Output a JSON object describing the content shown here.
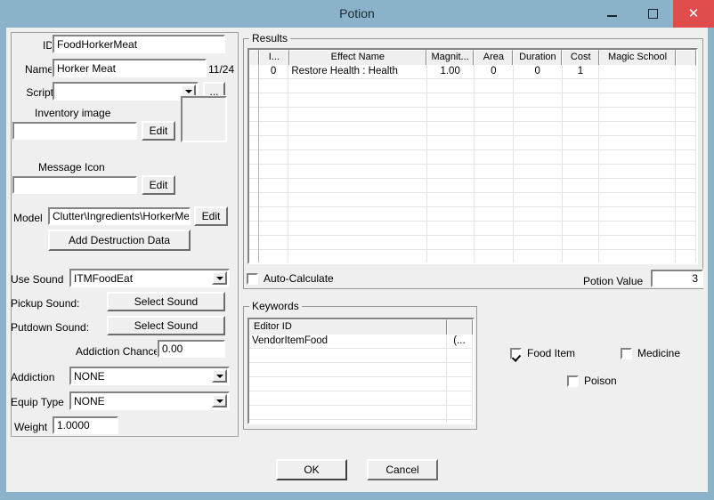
{
  "window": {
    "title": "Potion",
    "minimize": "–",
    "maximize": "□",
    "close": "✕"
  },
  "left_panel": {
    "id_label": "ID",
    "id_value": "FoodHorkerMeat",
    "name_label": "Name",
    "name_value": "Horker Meat",
    "name_counter": "11/24",
    "script_label": "Script",
    "script_value": "",
    "script_browse": "...",
    "inventory_image_label": "Inventory image",
    "inventory_image_value": "",
    "inventory_edit": "Edit",
    "message_icon_label": "Message Icon",
    "message_icon_value": "",
    "message_edit": "Edit",
    "model_label": "Model",
    "model_value": "Clutter\\Ingredients\\HorkerMeat.r",
    "model_edit": "Edit",
    "add_destruction_data": "Add Destruction Data",
    "use_sound_label": "Use Sound",
    "use_sound_value": "ITMFoodEat",
    "pickup_sound_label": "Pickup Sound:",
    "pickup_sound_button": "Select Sound",
    "putdown_sound_label": "Putdown Sound:",
    "putdown_sound_button": "Select Sound",
    "addiction_chance_label": "Addiction Chance",
    "addiction_chance_value": "0.00",
    "addiction_label": "Addiction",
    "addiction_value": "NONE",
    "equip_type_label": "Equip Type",
    "equip_type_value": "NONE",
    "weight_label": "Weight",
    "weight_value": "1.0000"
  },
  "results": {
    "group_title": "Results",
    "columns": [
      "I...",
      "Effect Name",
      "Magnit...",
      "Area",
      "Duration",
      "Cost",
      "Magic School",
      ""
    ],
    "rows": [
      {
        "index": "0",
        "effect_name": "Restore Health : Health",
        "magnitude": "1.00",
        "area": "0",
        "duration": "0",
        "cost": "1",
        "magic_school": "",
        "extra": ""
      }
    ],
    "auto_calculate_label": "Auto-Calculate",
    "auto_calculate_checked": false,
    "potion_value_label": "Potion Value",
    "potion_value": "3"
  },
  "keywords": {
    "group_title": "Keywords",
    "columns": [
      "Editor ID",
      ""
    ],
    "rows": [
      {
        "editor_id": "VendorItemFood",
        "extra": "(..."
      }
    ]
  },
  "flags": [
    {
      "label": "Food Item",
      "checked": true
    },
    {
      "label": "Medicine",
      "checked": false
    },
    {
      "label": "Poison",
      "checked": false
    }
  ],
  "footer": {
    "ok": "OK",
    "cancel": "Cancel"
  }
}
